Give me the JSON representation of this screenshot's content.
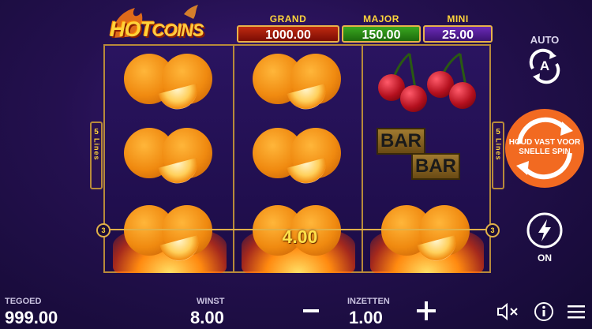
{
  "game": {
    "logo_hot": "HOT",
    "logo_coins": "COINS"
  },
  "jackpots": {
    "grand": {
      "label": "GRAND",
      "value": "1000.00"
    },
    "major": {
      "label": "MAJOR",
      "value": "150.00"
    },
    "mini": {
      "label": "MINI",
      "value": "25.00"
    }
  },
  "reels": {
    "lines_label_left": "5",
    "lines_word_left": "Lines",
    "lines_label_right": "5",
    "lines_word_right": "Lines",
    "payline_number_left": "3",
    "payline_number_right": "3",
    "win_amount": "4.00",
    "symbols": [
      [
        "orange",
        "orange",
        "orange-fire"
      ],
      [
        "orange",
        "orange",
        "orange-fire"
      ],
      [
        "cherry",
        "bar",
        "orange-fire"
      ]
    ],
    "bar_text": "BAR"
  },
  "controls": {
    "auto_label": "AUTO",
    "auto_icon_letter": "A",
    "spin_text_line1": "HOUD VAST VOOR",
    "spin_text_line2": "SNELLE SPIN",
    "turbo_label": "ON"
  },
  "footer": {
    "balance_label": "TEGOED",
    "balance_value": "999.00",
    "win_label": "WINST",
    "win_value": "8.00",
    "bet_label": "INZETTEN",
    "bet_value": "1.00"
  },
  "colors": {
    "background": "#24104f",
    "frame_gold": "#b88a3a",
    "spin_orange": "#f26a21",
    "grand_red": "#a01c08",
    "major_green": "#2a8c16",
    "mini_purple": "#5a1f9a"
  }
}
